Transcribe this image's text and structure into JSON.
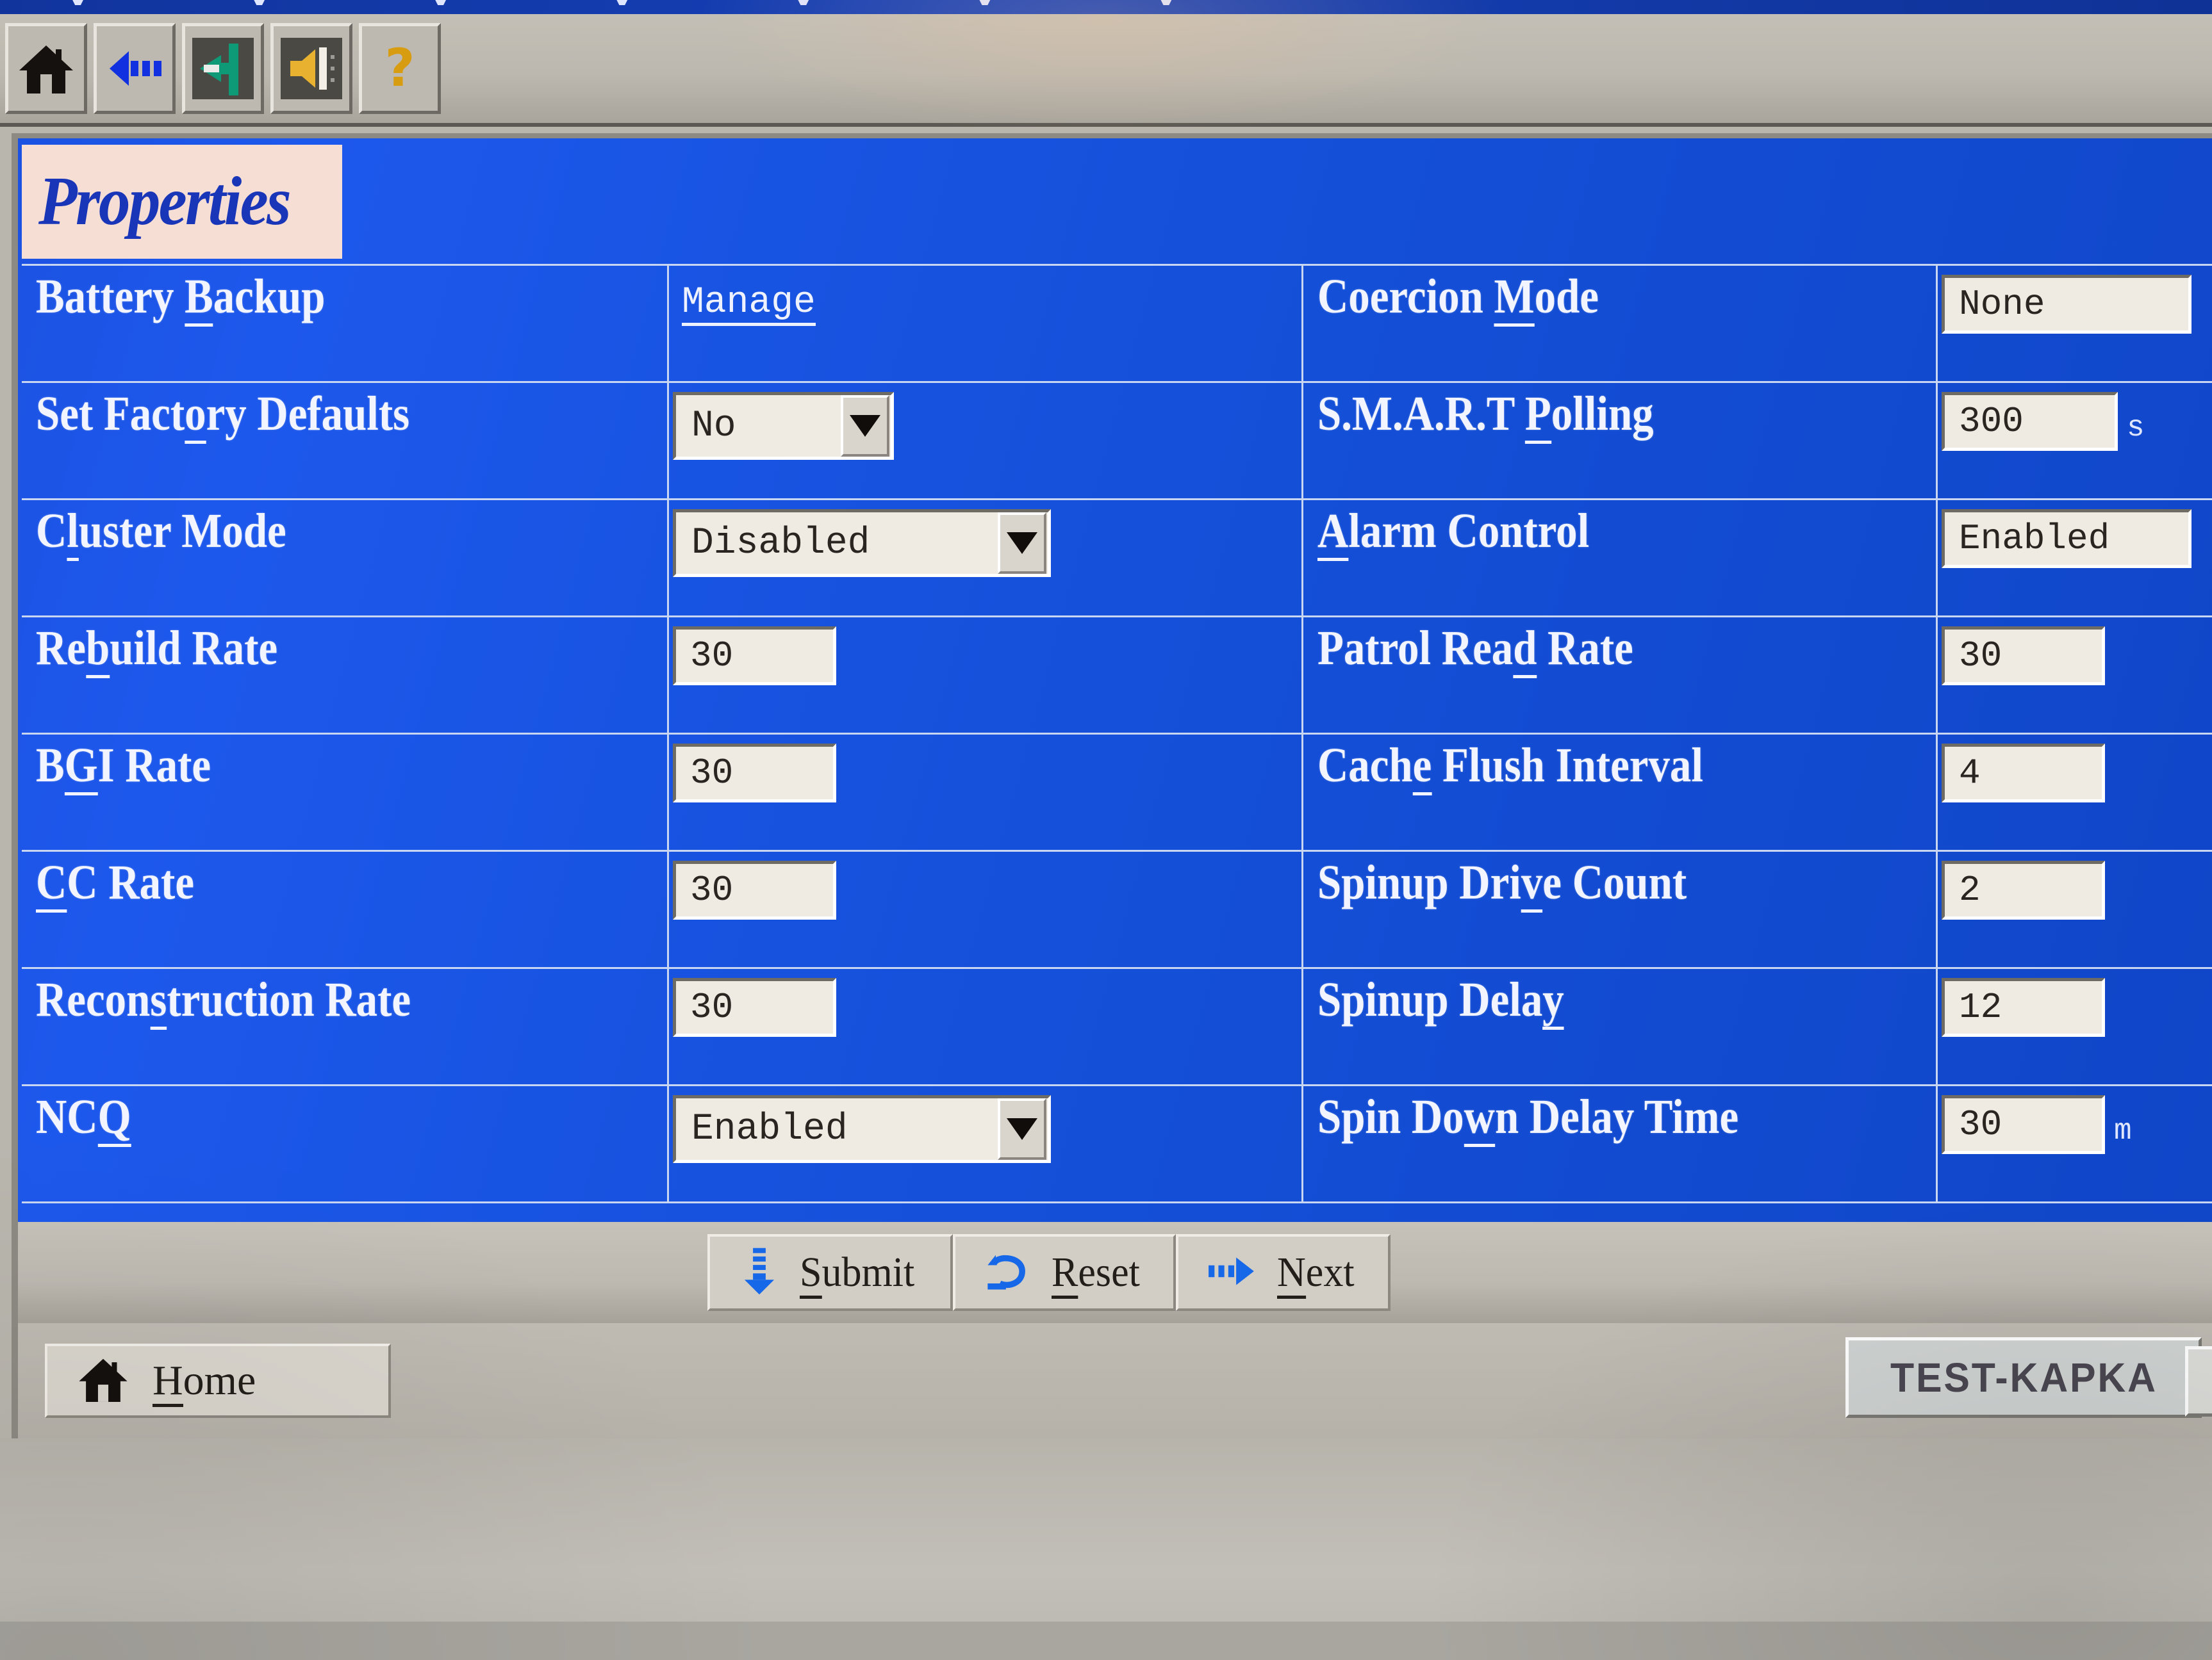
{
  "toolbar": {
    "buttons": [
      {
        "name": "home-icon",
        "tooltip": "Home"
      },
      {
        "name": "back-icon",
        "tooltip": "Back"
      },
      {
        "name": "logout-icon",
        "tooltip": "Log Out"
      },
      {
        "name": "sound-icon",
        "tooltip": "Sound"
      },
      {
        "name": "help-icon",
        "tooltip": "Help"
      }
    ]
  },
  "panel": {
    "title": "Properties"
  },
  "properties": {
    "left": [
      {
        "label_pre": "Battery ",
        "label_acc": "B",
        "label_post": "ackup",
        "type": "link",
        "value": "Manage"
      },
      {
        "label_pre": "Set Fact",
        "label_acc": "o",
        "label_post": "ry Defaults",
        "type": "select",
        "value": "No",
        "width": "w-no"
      },
      {
        "label_pre": "C",
        "label_acc": "l",
        "label_post": "uster Mode",
        "type": "select",
        "value": "Disabled",
        "width": "w-dis"
      },
      {
        "label_pre": "Re",
        "label_acc": "b",
        "label_post": "uild Rate",
        "type": "text",
        "value": "30",
        "width": "w-sm"
      },
      {
        "label_pre": "B",
        "label_acc": "G",
        "label_post": "I Rate",
        "type": "text",
        "value": "30",
        "width": "w-sm"
      },
      {
        "label_pre": "",
        "label_acc": "C",
        "label_post": "C Rate",
        "type": "text",
        "value": "30",
        "width": "w-sm"
      },
      {
        "label_pre": "Recon",
        "label_acc": "s",
        "label_post": "truction Rate",
        "type": "text",
        "value": "30",
        "width": "w-sm"
      },
      {
        "label_pre": "NC",
        "label_acc": "Q",
        "label_post": "",
        "type": "select",
        "value": "Enabled",
        "width": "w-en"
      }
    ],
    "right": [
      {
        "label_pre": "Coercion ",
        "label_acc": "M",
        "label_post": "ode",
        "type": "text",
        "value": "None",
        "width": "w-lg",
        "unit": ""
      },
      {
        "label_pre": "S.M.A.R.T ",
        "label_acc": "P",
        "label_post": "olling",
        "type": "text",
        "value": "300",
        "width": "w-md",
        "unit": "s"
      },
      {
        "label_pre": "",
        "label_acc": "A",
        "label_post": "larm Control",
        "type": "text",
        "value": "Enabled",
        "width": "w-lg",
        "unit": ""
      },
      {
        "label_pre": "Patrol Rea",
        "label_acc": "d",
        "label_post": " Rate",
        "type": "text",
        "value": "30",
        "width": "w-sm",
        "unit": ""
      },
      {
        "label_pre": "Cach",
        "label_acc": "e",
        "label_post": " Flush Interval",
        "type": "text",
        "value": "4",
        "width": "w-sm",
        "unit": ""
      },
      {
        "label_pre": "Spinup Dri",
        "label_acc": "v",
        "label_post": "e Count",
        "type": "text",
        "value": "2",
        "width": "w-sm",
        "unit": ""
      },
      {
        "label_pre": "Spinup Dela",
        "label_acc": "y",
        "label_post": "",
        "type": "text",
        "value": "12",
        "width": "w-sm",
        "unit": ""
      },
      {
        "label_pre": "Spin Do",
        "label_acc": "w",
        "label_post": "n Delay Time",
        "type": "text",
        "value": "30",
        "width": "w-sm",
        "unit": "m"
      }
    ]
  },
  "actions": [
    {
      "icon": "down-arrow-icon",
      "pre": "",
      "acc": "S",
      "post": "ubmit"
    },
    {
      "icon": "undo-arrow-icon",
      "pre": "",
      "acc": "R",
      "post": "eset"
    },
    {
      "icon": "right-arrow-icon",
      "pre": "",
      "acc": "N",
      "post": "ext"
    }
  ],
  "bottom": {
    "home": {
      "icon": "home-icon",
      "pre": "",
      "acc": "H",
      "post": "ome"
    },
    "status": "TEST-KAPKA"
  },
  "colors": {
    "panel_blue": "#1550d8",
    "title_bg": "#f6ded4",
    "title_text": "#1a36b8",
    "label_text": "#f2f4ff",
    "field_bg": "#efebe2",
    "chrome_gray": "#bdb9b0",
    "accent_blue": "#1668e8"
  }
}
